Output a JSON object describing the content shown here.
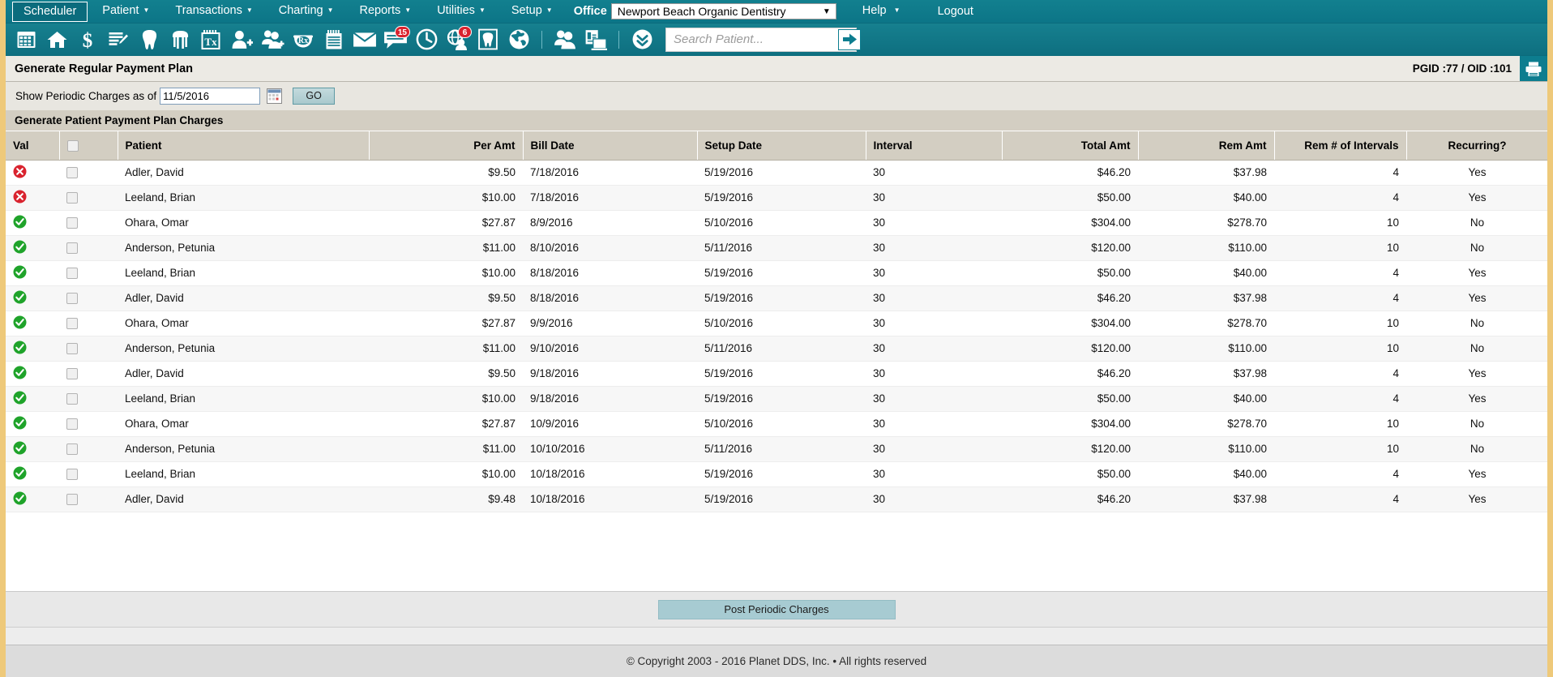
{
  "menu": {
    "items": [
      {
        "label": "Scheduler",
        "active": true,
        "caret": false
      },
      {
        "label": "Patient",
        "active": false,
        "caret": true
      },
      {
        "label": "Transactions",
        "active": false,
        "caret": true
      },
      {
        "label": "Charting",
        "active": false,
        "caret": true
      },
      {
        "label": "Reports",
        "active": false,
        "caret": true
      },
      {
        "label": "Utilities",
        "active": false,
        "caret": true
      },
      {
        "label": "Setup",
        "active": false,
        "caret": true
      }
    ],
    "office_label": "Office",
    "office_value": "Newport Beach Organic Dentistry",
    "help_label": "Help",
    "logout_label": "Logout"
  },
  "toolbar": {
    "icons": [
      {
        "name": "calendar-icon",
        "badge": null
      },
      {
        "name": "home-icon",
        "badge": null
      },
      {
        "name": "dollar-icon",
        "badge": null
      },
      {
        "name": "notes-edit-icon",
        "badge": null
      },
      {
        "name": "tooth-icon",
        "badge": null
      },
      {
        "name": "perio-icon",
        "badge": null
      },
      {
        "name": "treatment-plan-icon",
        "badge": null
      },
      {
        "name": "add-patient-icon",
        "badge": null
      },
      {
        "name": "family-add-icon",
        "badge": null
      },
      {
        "name": "prescription-icon",
        "badge": null
      },
      {
        "name": "document-list-icon",
        "badge": null
      },
      {
        "name": "mail-icon",
        "badge": null
      },
      {
        "name": "messages-icon",
        "badge": "15"
      },
      {
        "name": "clock-icon",
        "badge": null
      },
      {
        "name": "global-patient-icon",
        "badge": "6"
      },
      {
        "name": "tooth-chart-icon",
        "badge": null
      },
      {
        "name": "globe-icon",
        "badge": null
      }
    ],
    "icons_group2": [
      {
        "name": "users-icon",
        "badge": null
      },
      {
        "name": "reports-ui-icon",
        "badge": null
      }
    ],
    "icons_group3": [
      {
        "name": "double-chevron-down-icon",
        "badge": null
      }
    ],
    "search_placeholder": "Search Patient...",
    "search_value": "",
    "search_go_name": "search-submit-icon"
  },
  "page": {
    "title": "Generate Regular Payment Plan",
    "pgid_oid": "PGID :77  /  OID :101",
    "print_icon": "printer-icon"
  },
  "filter": {
    "label": "Show Periodic Charges as of",
    "date_value": "11/5/2016",
    "calendar_icon": "calendar-picker-icon",
    "go_label": "GO"
  },
  "section": {
    "heading": "Generate Patient Payment Plan Charges"
  },
  "table": {
    "headers": [
      "Val",
      "",
      "Patient",
      "Per Amt",
      "Bill Date",
      "Setup Date",
      "Interval",
      "Total Amt",
      "Rem Amt",
      "Rem # of Intervals",
      "Recurring?"
    ],
    "select_all_checked": false,
    "rows": [
      {
        "val": "invalid",
        "checked": false,
        "patient": "Adler, David",
        "per_amt": "$9.50",
        "bill_date": "7/18/2016",
        "setup_date": "5/19/2016",
        "interval": "30",
        "total_amt": "$46.20",
        "rem_amt": "$37.98",
        "rem_intervals": "4",
        "recurring": "Yes"
      },
      {
        "val": "invalid",
        "checked": false,
        "patient": "Leeland, Brian",
        "per_amt": "$10.00",
        "bill_date": "7/18/2016",
        "setup_date": "5/19/2016",
        "interval": "30",
        "total_amt": "$50.00",
        "rem_amt": "$40.00",
        "rem_intervals": "4",
        "recurring": "Yes"
      },
      {
        "val": "valid",
        "checked": false,
        "patient": "Ohara, Omar",
        "per_amt": "$27.87",
        "bill_date": "8/9/2016",
        "setup_date": "5/10/2016",
        "interval": "30",
        "total_amt": "$304.00",
        "rem_amt": "$278.70",
        "rem_intervals": "10",
        "recurring": "No"
      },
      {
        "val": "valid",
        "checked": false,
        "patient": "Anderson, Petunia",
        "per_amt": "$11.00",
        "bill_date": "8/10/2016",
        "setup_date": "5/11/2016",
        "interval": "30",
        "total_amt": "$120.00",
        "rem_amt": "$110.00",
        "rem_intervals": "10",
        "recurring": "No"
      },
      {
        "val": "valid",
        "checked": false,
        "patient": "Leeland, Brian",
        "per_amt": "$10.00",
        "bill_date": "8/18/2016",
        "setup_date": "5/19/2016",
        "interval": "30",
        "total_amt": "$50.00",
        "rem_amt": "$40.00",
        "rem_intervals": "4",
        "recurring": "Yes"
      },
      {
        "val": "valid",
        "checked": false,
        "patient": "Adler, David",
        "per_amt": "$9.50",
        "bill_date": "8/18/2016",
        "setup_date": "5/19/2016",
        "interval": "30",
        "total_amt": "$46.20",
        "rem_amt": "$37.98",
        "rem_intervals": "4",
        "recurring": "Yes"
      },
      {
        "val": "valid",
        "checked": false,
        "patient": "Ohara, Omar",
        "per_amt": "$27.87",
        "bill_date": "9/9/2016",
        "setup_date": "5/10/2016",
        "interval": "30",
        "total_amt": "$304.00",
        "rem_amt": "$278.70",
        "rem_intervals": "10",
        "recurring": "No"
      },
      {
        "val": "valid",
        "checked": false,
        "patient": "Anderson, Petunia",
        "per_amt": "$11.00",
        "bill_date": "9/10/2016",
        "setup_date": "5/11/2016",
        "interval": "30",
        "total_amt": "$120.00",
        "rem_amt": "$110.00",
        "rem_intervals": "10",
        "recurring": "No"
      },
      {
        "val": "valid",
        "checked": false,
        "patient": "Adler, David",
        "per_amt": "$9.50",
        "bill_date": "9/18/2016",
        "setup_date": "5/19/2016",
        "interval": "30",
        "total_amt": "$46.20",
        "rem_amt": "$37.98",
        "rem_intervals": "4",
        "recurring": "Yes"
      },
      {
        "val": "valid",
        "checked": false,
        "patient": "Leeland, Brian",
        "per_amt": "$10.00",
        "bill_date": "9/18/2016",
        "setup_date": "5/19/2016",
        "interval": "30",
        "total_amt": "$50.00",
        "rem_amt": "$40.00",
        "rem_intervals": "4",
        "recurring": "Yes"
      },
      {
        "val": "valid",
        "checked": false,
        "patient": "Ohara, Omar",
        "per_amt": "$27.87",
        "bill_date": "10/9/2016",
        "setup_date": "5/10/2016",
        "interval": "30",
        "total_amt": "$304.00",
        "rem_amt": "$278.70",
        "rem_intervals": "10",
        "recurring": "No"
      },
      {
        "val": "valid",
        "checked": false,
        "patient": "Anderson, Petunia",
        "per_amt": "$11.00",
        "bill_date": "10/10/2016",
        "setup_date": "5/11/2016",
        "interval": "30",
        "total_amt": "$120.00",
        "rem_amt": "$110.00",
        "rem_intervals": "10",
        "recurring": "No"
      },
      {
        "val": "valid",
        "checked": false,
        "patient": "Leeland, Brian",
        "per_amt": "$10.00",
        "bill_date": "10/18/2016",
        "setup_date": "5/19/2016",
        "interval": "30",
        "total_amt": "$50.00",
        "rem_amt": "$40.00",
        "rem_intervals": "4",
        "recurring": "Yes"
      },
      {
        "val": "valid",
        "checked": false,
        "patient": "Adler, David",
        "per_amt": "$9.48",
        "bill_date": "10/18/2016",
        "setup_date": "5/19/2016",
        "interval": "30",
        "total_amt": "$46.20",
        "rem_amt": "$37.98",
        "rem_intervals": "4",
        "recurring": "Yes"
      }
    ]
  },
  "actions": {
    "post_label": "Post Periodic Charges"
  },
  "footer": {
    "copyright": "© Copyright 2003 - 2016 Planet DDS, Inc. • All rights reserved"
  },
  "colors": {
    "teal": "#0d7d8f",
    "accent_gold": "#eec97a",
    "header_beige": "#d3cec2",
    "valid_green": "#1fa32a",
    "invalid_red": "#d9232e",
    "button_blue": "#a7cbd2"
  }
}
